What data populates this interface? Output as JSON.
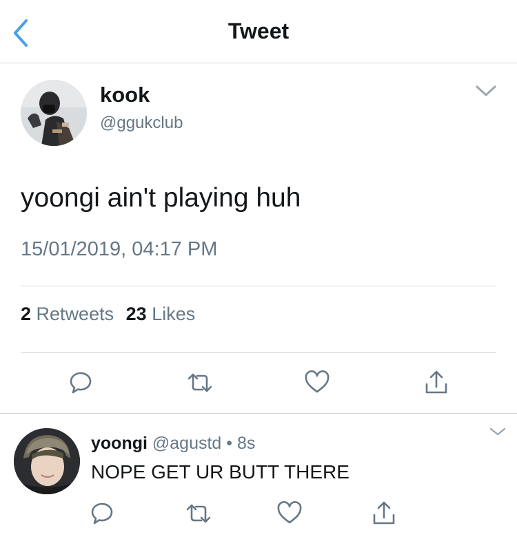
{
  "nav": {
    "title": "Tweet",
    "back_icon": "chevron-left-icon",
    "accent": "#4a9fe8"
  },
  "tweet": {
    "author_name": "kook",
    "author_handle": "@ggukclub",
    "text": "yoongi ain't playing huh",
    "timestamp": "15/01/2019, 04:17 PM",
    "retweets_count": "2",
    "retweets_label": "Retweets",
    "likes_count": "23",
    "likes_label": "Likes",
    "actions": [
      "reply-icon",
      "retweet-icon",
      "like-icon",
      "share-icon"
    ]
  },
  "reply": {
    "author_name": "yoongi",
    "author_handle": "@agustd",
    "separator": "•",
    "time": "8s",
    "text": "NOPE GET UR BUTT THERE",
    "actions": [
      "reply-icon",
      "retweet-icon",
      "like-icon",
      "share-icon"
    ]
  },
  "colors": {
    "text_primary": "#14171a",
    "text_secondary": "#657786",
    "divider": "#cfd5da",
    "icon": "#657786"
  }
}
